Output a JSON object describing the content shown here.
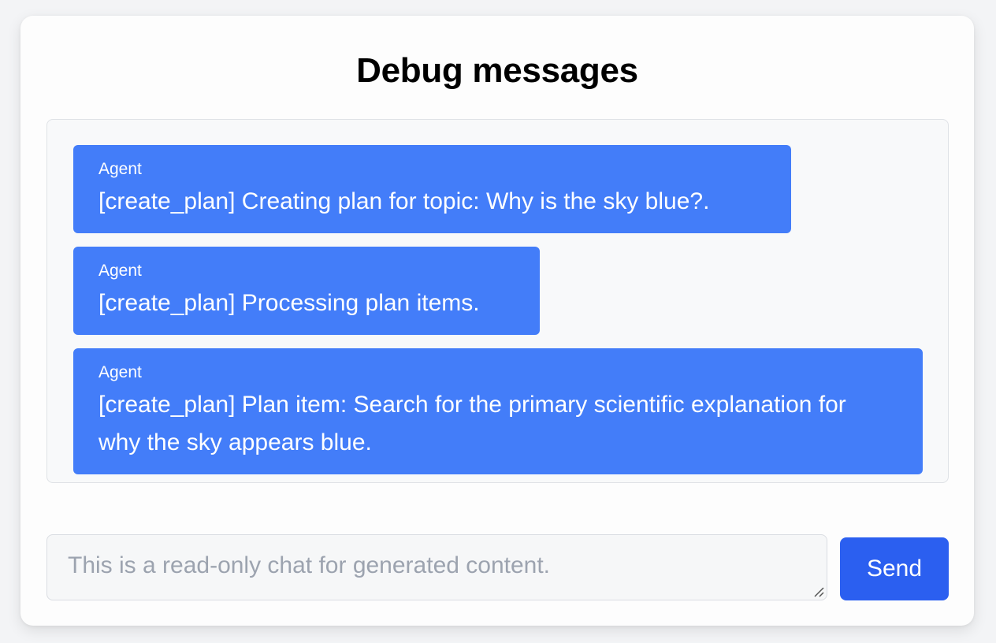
{
  "panel": {
    "title": "Debug messages"
  },
  "messages": [
    {
      "sender": "Agent",
      "text": "[create_plan] Creating plan for topic: Why is the sky blue?."
    },
    {
      "sender": "Agent",
      "text": "[create_plan] Processing plan items."
    },
    {
      "sender": "Agent",
      "text": "[create_plan] Plan item: Search for the primary scientific explanation for why the sky appears blue."
    }
  ],
  "composer": {
    "placeholder": "This is a read-only chat for generated content.",
    "value": "",
    "send_label": "Send"
  },
  "colors": {
    "message_bubble": "#437df9",
    "send_button": "#2b5ff0",
    "messages_background": "#f8f9fa"
  }
}
